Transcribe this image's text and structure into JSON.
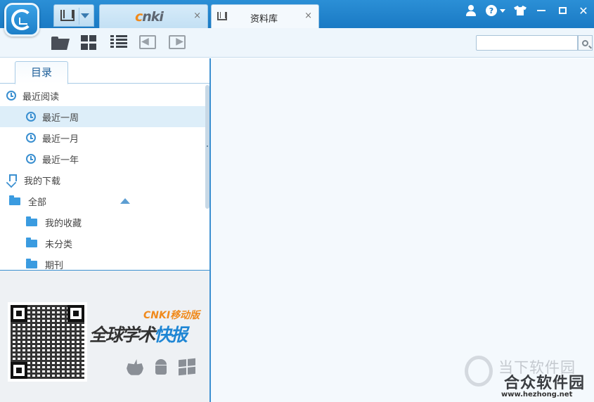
{
  "tabs": {
    "cnki_logo_c": "c",
    "cnki_logo_rest": "nki",
    "library_label": "资料库",
    "close_glyph": "×"
  },
  "window": {
    "help_glyph": "?",
    "close_glyph": "✕"
  },
  "sidebar": {
    "tab_label": "目录",
    "items": [
      {
        "label": "最近阅读",
        "icon": "clock-icon"
      },
      {
        "label": "最近一周",
        "icon": "clock-icon",
        "selected": true
      },
      {
        "label": "最近一月",
        "icon": "clock-icon"
      },
      {
        "label": "最近一年",
        "icon": "clock-icon"
      },
      {
        "label": "我的下载",
        "icon": "download-icon"
      },
      {
        "label": "全部",
        "icon": "folder-icon",
        "expanded": true
      },
      {
        "label": "我的收藏",
        "icon": "folder-icon"
      },
      {
        "label": "未分类",
        "icon": "folder-icon"
      },
      {
        "label": "期刊",
        "icon": "folder-icon"
      }
    ]
  },
  "promo": {
    "brand_cnki": "CNKI",
    "brand_suffix": "移动版",
    "title_main": "全球学术",
    "title_highlight": "快报"
  },
  "watermark": {
    "line1": "当下软件园",
    "line2": "合众软件园",
    "url": "www.hezhong.net"
  },
  "colors": {
    "accent": "#1a7ac4",
    "sidebar_selected": "#ddeef9",
    "brand_orange": "#f08a1c"
  }
}
